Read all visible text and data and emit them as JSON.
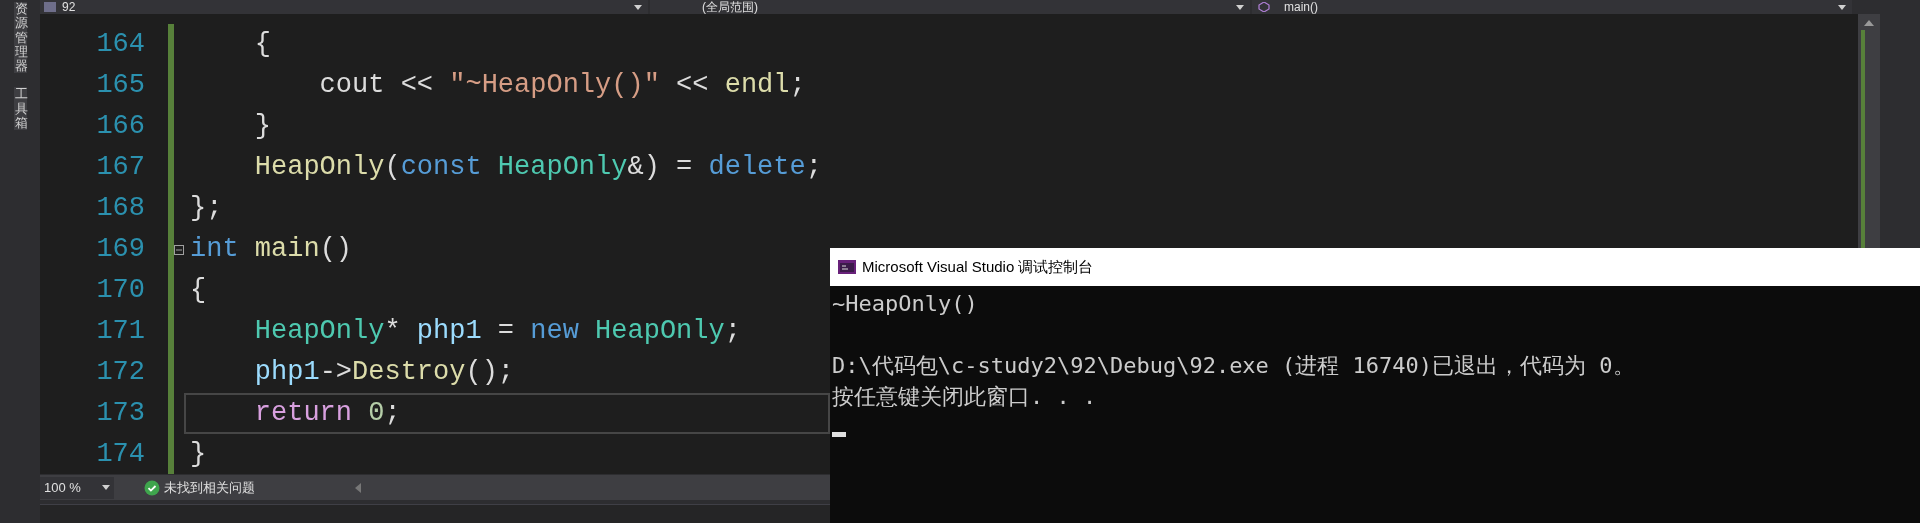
{
  "tool_strip": [
    {
      "label": "资源管理器"
    },
    {
      "label": "工具箱"
    }
  ],
  "nav_bar": {
    "project": "92",
    "scope": "(全局范围)",
    "member": "main()"
  },
  "code_lines": [
    {
      "number": "164",
      "current": false,
      "foldable": false,
      "tokens": [
        {
          "kind": "plain",
          "text": "    {"
        }
      ]
    },
    {
      "number": "165",
      "current": false,
      "foldable": false,
      "tokens": [
        {
          "kind": "plain",
          "text": "        cout << "
        },
        {
          "kind": "string",
          "text": "\"~HeapOnly()\""
        },
        {
          "kind": "plain",
          "text": " << "
        },
        {
          "kind": "function",
          "text": "endl"
        },
        {
          "kind": "plain",
          "text": ";"
        }
      ]
    },
    {
      "number": "166",
      "current": false,
      "foldable": false,
      "tokens": [
        {
          "kind": "plain",
          "text": "    }"
        }
      ]
    },
    {
      "number": "167",
      "current": false,
      "foldable": false,
      "tokens": [
        {
          "kind": "function",
          "text": "    HeapOnly"
        },
        {
          "kind": "plain",
          "text": "("
        },
        {
          "kind": "keyword",
          "text": "const "
        },
        {
          "kind": "type",
          "text": "HeapOnly"
        },
        {
          "kind": "plain",
          "text": "&) = "
        },
        {
          "kind": "keyword",
          "text": "delete"
        },
        {
          "kind": "plain",
          "text": ";"
        }
      ]
    },
    {
      "number": "168",
      "current": false,
      "foldable": false,
      "tokens": [
        {
          "kind": "plain",
          "text": "};"
        }
      ]
    },
    {
      "number": "169",
      "current": false,
      "foldable": true,
      "tokens": [
        {
          "kind": "keyword",
          "text": "int "
        },
        {
          "kind": "function",
          "text": "main"
        },
        {
          "kind": "plain",
          "text": "()"
        }
      ]
    },
    {
      "number": "170",
      "current": false,
      "foldable": false,
      "tokens": [
        {
          "kind": "plain",
          "text": "{"
        }
      ]
    },
    {
      "number": "171",
      "current": false,
      "foldable": false,
      "tokens": [
        {
          "kind": "type",
          "text": "    HeapOnly"
        },
        {
          "kind": "plain",
          "text": "* "
        },
        {
          "kind": "variable",
          "text": "php1"
        },
        {
          "kind": "plain",
          "text": " = "
        },
        {
          "kind": "keyword",
          "text": "new "
        },
        {
          "kind": "type",
          "text": "HeapOnly"
        },
        {
          "kind": "plain",
          "text": ";"
        }
      ]
    },
    {
      "number": "172",
      "current": false,
      "foldable": false,
      "tokens": [
        {
          "kind": "variable",
          "text": "    php1"
        },
        {
          "kind": "plain",
          "text": "->"
        },
        {
          "kind": "function",
          "text": "Destroy"
        },
        {
          "kind": "plain",
          "text": "();"
        }
      ]
    },
    {
      "number": "173",
      "current": true,
      "foldable": false,
      "tokens": [
        {
          "kind": "control",
          "text": "    return "
        },
        {
          "kind": "number",
          "text": "0"
        },
        {
          "kind": "plain",
          "text": ";"
        }
      ]
    },
    {
      "number": "174",
      "current": false,
      "foldable": false,
      "tokens": [
        {
          "kind": "plain",
          "text": "}"
        }
      ]
    }
  ],
  "status_bar": {
    "zoom": "100 %",
    "issues": "未找到相关问题"
  },
  "console": {
    "title": "Microsoft Visual Studio 调试控制台",
    "program_output": [
      "~HeapOnly()"
    ],
    "exit_messages": [
      "D:\\代码包\\c-study2\\92\\Debug\\92.exe (进程 16740)已退出，代码为 0。",
      "按任意键关闭此窗口. . ."
    ]
  }
}
